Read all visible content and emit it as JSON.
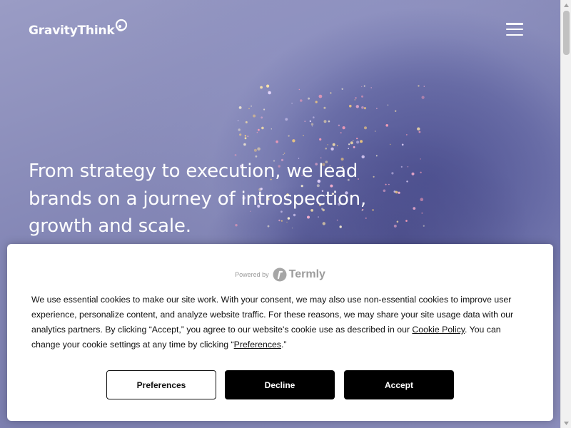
{
  "header": {
    "logo_text": "GravityThink",
    "menu_icon": "hamburger-menu-icon"
  },
  "hero": {
    "headline": "From strategy to execution, we lead brands on a journey of introspection, growth and scale."
  },
  "cookie_banner": {
    "powered_by": "Powered by",
    "provider": "Termly",
    "text_before_policy": "We use essential cookies to make our site work. With your consent, we may also use non-essential cookies to improve user experience, personalize content, and analyze website traffic. For these reasons, we may share your site usage data with our analytics partners. By clicking “Accept,” you agree to our website's cookie use as described in our ",
    "policy_link": "Cookie Policy",
    "text_middle": ". You can change your cookie settings at any time by clicking “",
    "preferences_link": "Preferences",
    "text_end": ".”",
    "buttons": {
      "preferences": "Preferences",
      "decline": "Decline",
      "accept": "Accept"
    }
  },
  "colors": {
    "hero_tint": "#8b8fb8",
    "button_dark": "#000000",
    "banner_bg": "#ffffff"
  }
}
